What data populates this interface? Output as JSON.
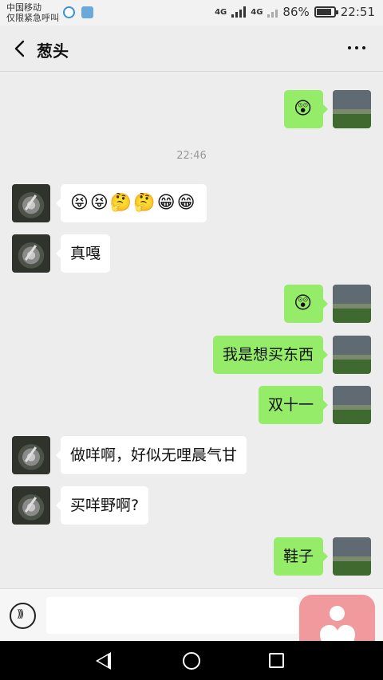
{
  "status_bar": {
    "carrier_line1": "中国移动",
    "carrier_line2": "仅限紧急呼叫",
    "network_1": "4G",
    "network_2": "4G",
    "battery": "86%",
    "time": "22:51"
  },
  "header": {
    "title": "葱头"
  },
  "timestamp": "22:46",
  "messages": [
    {
      "side": "right",
      "text": "😲"
    },
    {
      "side": "left",
      "text": "😝😝🤔🤔😁😁"
    },
    {
      "side": "left",
      "text": "真嘎"
    },
    {
      "side": "right",
      "text": "😲"
    },
    {
      "side": "right",
      "text": "我是想买东西"
    },
    {
      "side": "right",
      "text": "双十一"
    },
    {
      "side": "left",
      "text": "做咩啊，好似无哩晨气甘"
    },
    {
      "side": "left",
      "text": "买咩野啊?"
    },
    {
      "side": "right",
      "text": "鞋子"
    }
  ],
  "input": {
    "placeholder": ""
  },
  "icons": {
    "back": "chevron-left-icon",
    "more": "more-dots-icon",
    "voice": "voice-icon"
  },
  "colors": {
    "sent_bubble": "#95ec69",
    "received_bubble": "#ffffff",
    "background": "#ededed"
  }
}
